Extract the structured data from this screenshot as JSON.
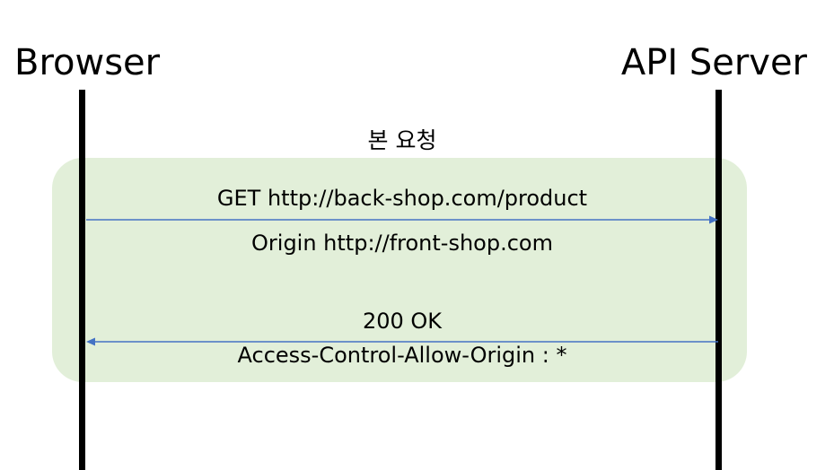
{
  "actors": {
    "left": "Browser",
    "right": "API Server"
  },
  "group": {
    "title": "본 요청"
  },
  "request": {
    "line1": "GET http://back-shop.com/product",
    "line2": "Origin http://front-shop.com"
  },
  "response": {
    "line1": "200 OK",
    "line2": "Access-Control-Allow-Origin : *"
  },
  "colors": {
    "group_fill": "#e2efd9",
    "arrow": "#4472c4",
    "lifeline": "#000000"
  }
}
